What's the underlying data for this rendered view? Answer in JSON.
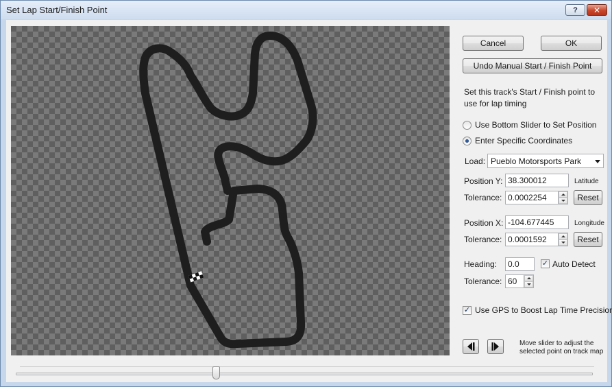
{
  "window": {
    "title": "Set Lap Start/Finish Point",
    "help_label": "?",
    "close_label": "✕"
  },
  "buttons": {
    "cancel": "Cancel",
    "ok": "OK",
    "undo": "Undo Manual Start / Finish Point",
    "reset_y": "Reset",
    "reset_x": "Reset"
  },
  "description": "Set this track's Start / Finish point to use for lap timing",
  "options": {
    "use_slider": "Use Bottom Slider to Set Position",
    "enter_coords": "Enter Specific Coordinates",
    "selected": "enter_coords"
  },
  "load": {
    "label": "Load:",
    "value": "Pueblo Motorsports Park"
  },
  "position_y": {
    "label": "Position Y:",
    "value": "38.300012",
    "unit": "Latitude",
    "tolerance_label": "Tolerance:",
    "tolerance": "0.0002254"
  },
  "position_x": {
    "label": "Position X:",
    "value": "-104.677445",
    "unit": "Longitude",
    "tolerance_label": "Tolerance:",
    "tolerance": "0.0001592"
  },
  "heading": {
    "label": "Heading:",
    "value": "0.0",
    "auto_detect_label": "Auto Detect",
    "auto_detect": true,
    "tolerance_label": "Tolerance:",
    "tolerance": "60"
  },
  "gps_boost": {
    "label": "Use GPS to Boost Lap Time Precision",
    "checked": true
  },
  "slider": {
    "hint": "Move slider to adjust the selected point on track map",
    "position_fraction": 0.345
  },
  "icons": {
    "step_back": "step-back-icon",
    "step_forward": "step-forward-icon",
    "finish_marker": "checkered-flag-icon"
  },
  "colors": {
    "track": "#1e1e1e",
    "checker_light": "#7a7a7a",
    "checker_dark": "#5f5f5f"
  }
}
